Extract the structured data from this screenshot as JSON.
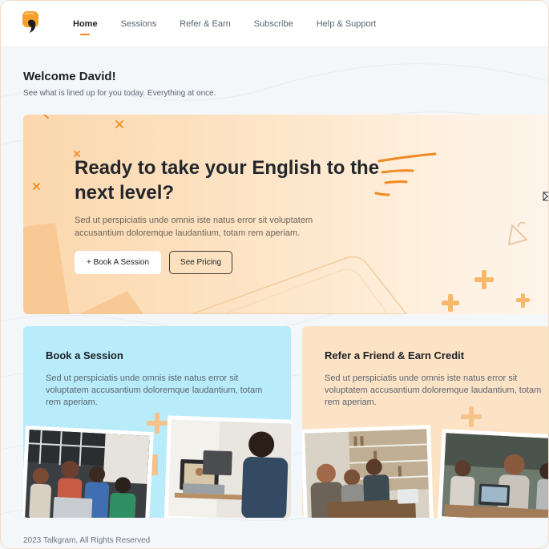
{
  "nav": {
    "items": [
      {
        "label": "Home",
        "active": true
      },
      {
        "label": "Sessions",
        "active": false
      },
      {
        "label": "Refer & Earn",
        "active": false
      },
      {
        "label": "Subscribe",
        "active": false
      },
      {
        "label": "Help & Support",
        "active": false
      }
    ]
  },
  "welcome": {
    "title": "Welcome David!",
    "subtitle": "See what is lined up for you today. Everything at once."
  },
  "hero": {
    "title": "Ready to take your English to the next level?",
    "text": "Sed ut perspiciatis unde omnis iste natus error sit voluptatem accusantium doloremque laudantium, totam rem aperiam.",
    "book_label": "+ Book A Session",
    "pricing_label": "See Pricing"
  },
  "cards": [
    {
      "title": "Book a Session",
      "text": "Sed ut perspiciatis unde omnis iste natus error sit voluptatem accusantium doloremque laudantium, totam rem aperiam."
    },
    {
      "title": "Refer a Friend & Earn Credit",
      "text": "Sed ut perspiciatis unde omnis iste natus error sit voluptatem accusantium doloremque laudantium, totam rem aperiam."
    }
  ],
  "footer": {
    "text": "2023 Talkgram, All Rights Reserved"
  },
  "colors": {
    "accent": "#f08a24",
    "hero_bg": "#fde5c7",
    "card_blue": "#b8ecfb",
    "card_peach": "#fde3c6"
  },
  "icons": {
    "logo": "talkgram-logo-icon",
    "envelope": "envelope-icon"
  }
}
